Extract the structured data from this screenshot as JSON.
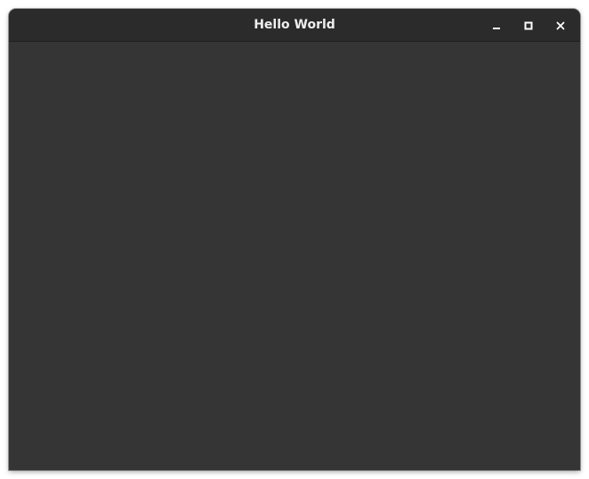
{
  "window": {
    "title": "Hello World",
    "colors": {
      "titlebar": "#2b2b2b",
      "content": "#353535",
      "title_text": "#eeeeee",
      "control_icon": "#ffffff"
    },
    "controls": [
      {
        "name": "minimize",
        "icon": "minimize-icon"
      },
      {
        "name": "maximize",
        "icon": "maximize-icon"
      },
      {
        "name": "close",
        "icon": "close-icon"
      }
    ]
  }
}
